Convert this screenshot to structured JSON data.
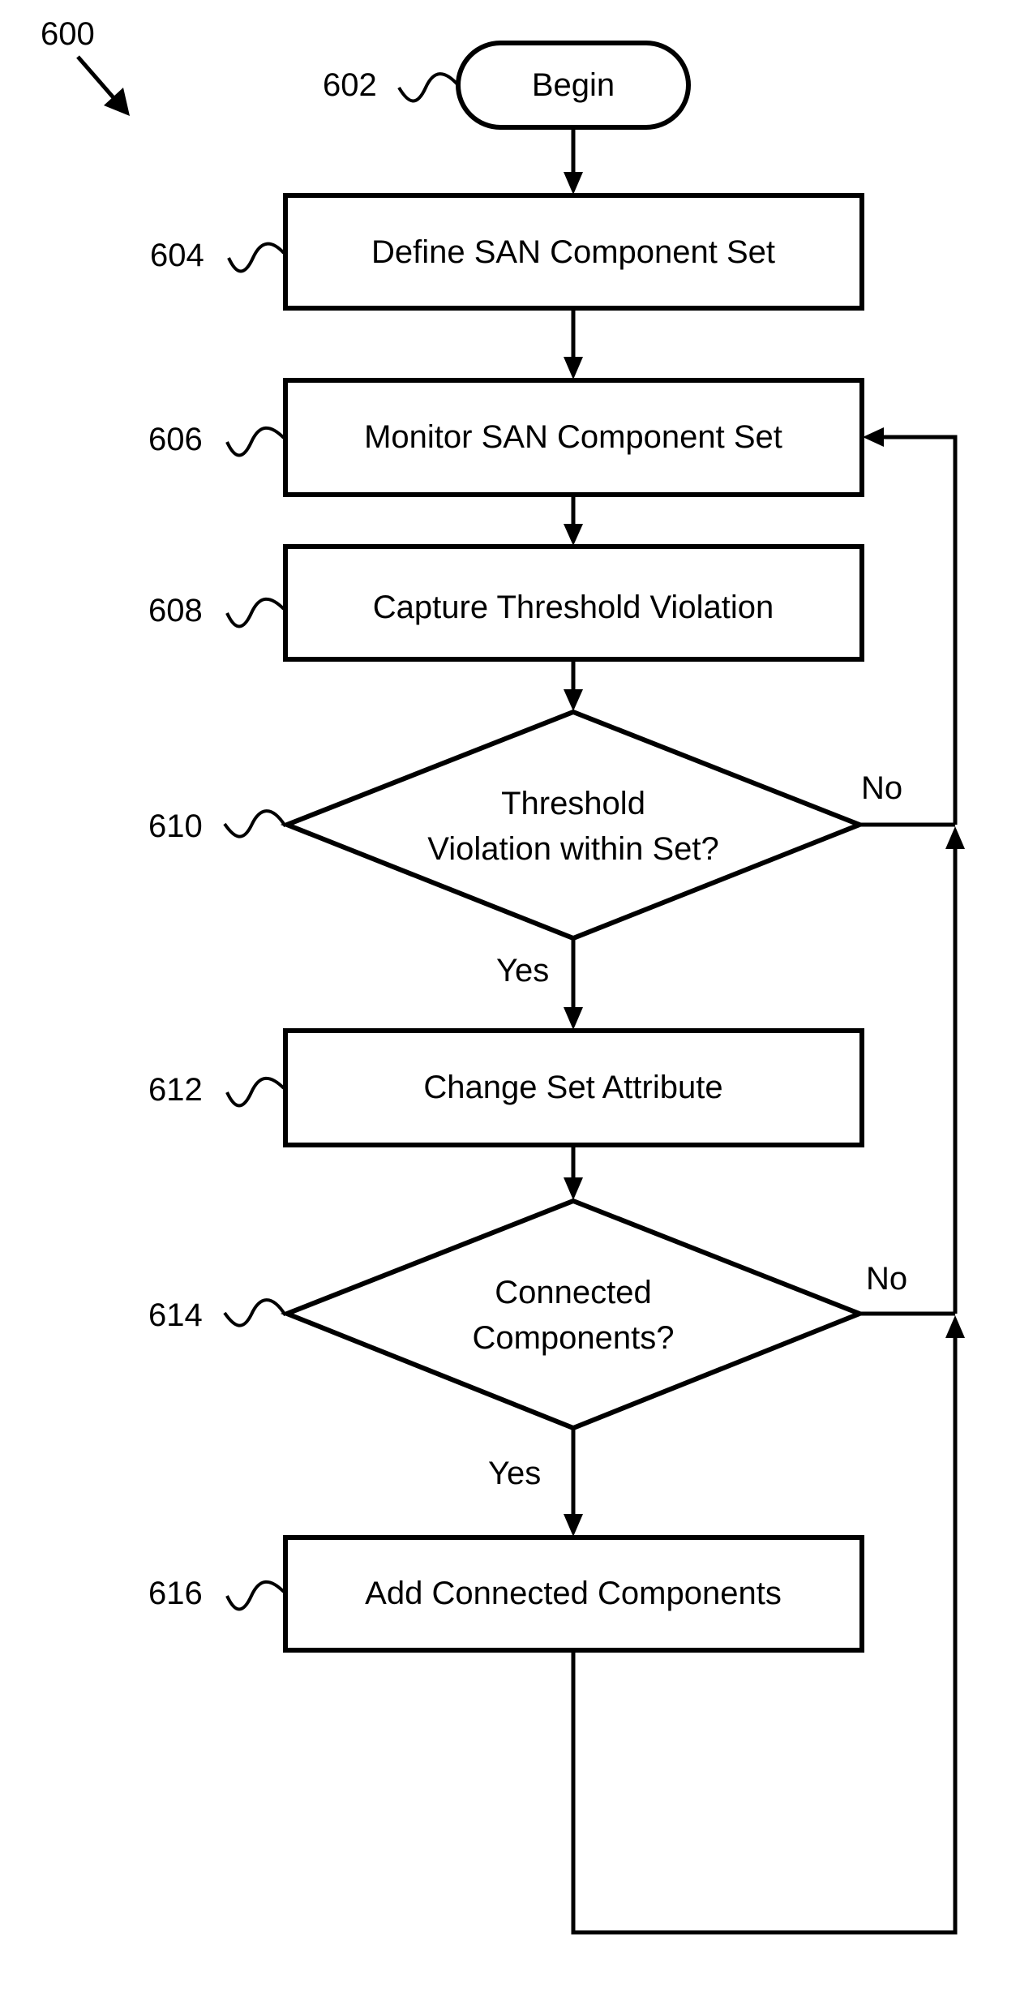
{
  "figure": {
    "ref": "600",
    "colors": {
      "ink": "#000000",
      "background": "#ffffff"
    }
  },
  "nodes": [
    {
      "id": "602",
      "type": "terminal",
      "text": [
        "Begin"
      ]
    },
    {
      "id": "604",
      "type": "process",
      "text": [
        "Define SAN Component Set"
      ]
    },
    {
      "id": "606",
      "type": "process",
      "text": [
        "Monitor SAN Component Set"
      ]
    },
    {
      "id": "608",
      "type": "process",
      "text": [
        "Capture Threshold Violation"
      ]
    },
    {
      "id": "610",
      "type": "decision",
      "text": [
        "Threshold",
        "Violation within Set?"
      ]
    },
    {
      "id": "612",
      "type": "process",
      "text": [
        "Change Set Attribute"
      ]
    },
    {
      "id": "614",
      "type": "decision",
      "text": [
        "Connected",
        "Components?"
      ]
    },
    {
      "id": "616",
      "type": "process",
      "text": [
        "Add Connected Components"
      ]
    }
  ],
  "edges": [
    {
      "from": "602",
      "to": "604",
      "label": ""
    },
    {
      "from": "604",
      "to": "606",
      "label": ""
    },
    {
      "from": "606",
      "to": "608",
      "label": ""
    },
    {
      "from": "608",
      "to": "610",
      "label": ""
    },
    {
      "from": "610",
      "to": "612",
      "label": "Yes"
    },
    {
      "from": "610",
      "to": "606",
      "label": "No"
    },
    {
      "from": "612",
      "to": "614",
      "label": ""
    },
    {
      "from": "614",
      "to": "616",
      "label": "Yes"
    },
    {
      "from": "614",
      "to": "606",
      "label": "No"
    },
    {
      "from": "616",
      "to": "606",
      "label": ""
    }
  ]
}
